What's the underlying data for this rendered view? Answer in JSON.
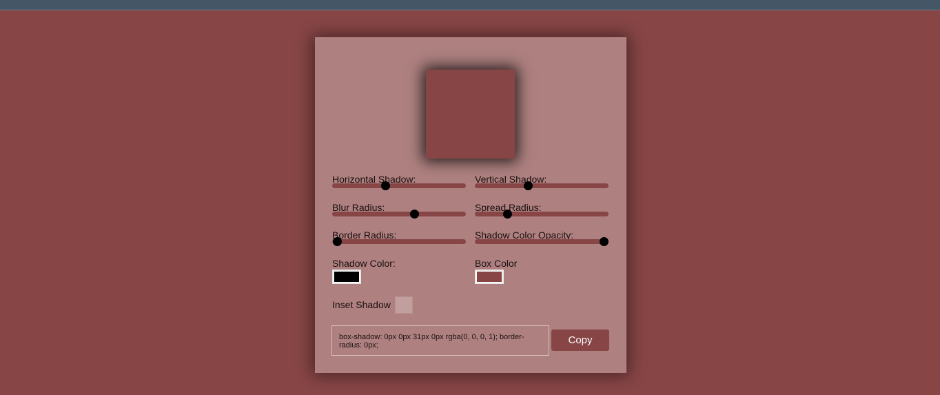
{
  "app": {
    "background_color": "#874546",
    "top_bar_color": "#455766",
    "panel_color": "#ae8180"
  },
  "controls": {
    "horizontal_shadow": {
      "label": "Horizontal Shadow:",
      "value_fraction": 0.39
    },
    "vertical_shadow": {
      "label": "Vertical Shadow:",
      "value_fraction": 0.39
    },
    "blur_radius": {
      "label": "Blur Radius:",
      "value_fraction": 0.62
    },
    "spread_radius": {
      "label": "Spread Radius:",
      "value_fraction": 0.22
    },
    "border_radius": {
      "label": "Border Radius:",
      "value_fraction": 0.0
    },
    "shadow_opacity": {
      "label": "Shadow Color Opacity:",
      "value_fraction": 1.0
    },
    "shadow_color": {
      "label": "Shadow Color:",
      "value": "#000000"
    },
    "box_color": {
      "label": "Box Color",
      "value": "#874546"
    },
    "inset_shadow": {
      "label": "Inset Shadow",
      "checked": false
    }
  },
  "output": {
    "css_text": "box-shadow: 0px 0px 31px 0px rgba(0, 0, 0, 1); border-radius: 0px;",
    "copy_label": "Copy"
  }
}
